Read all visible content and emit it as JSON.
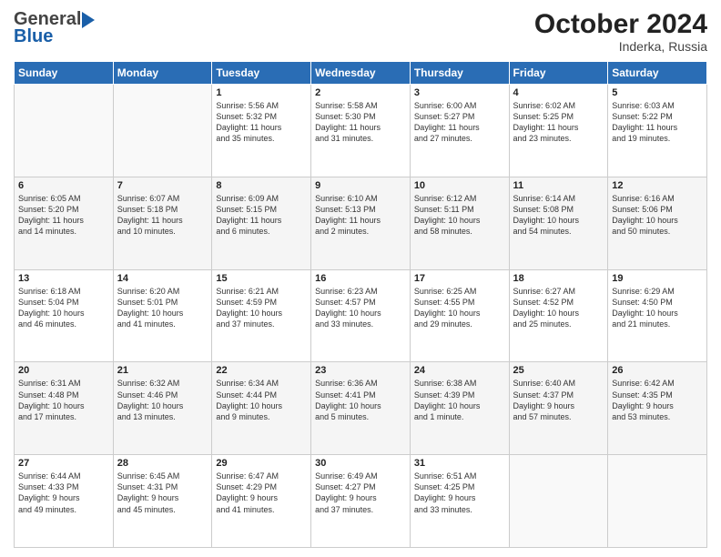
{
  "header": {
    "logo": {
      "line1": "General",
      "line2": "Blue"
    },
    "title": "October 2024",
    "location": "Inderka, Russia"
  },
  "weekdays": [
    "Sunday",
    "Monday",
    "Tuesday",
    "Wednesday",
    "Thursday",
    "Friday",
    "Saturday"
  ],
  "weeks": [
    [
      {
        "day": "",
        "info": ""
      },
      {
        "day": "",
        "info": ""
      },
      {
        "day": "1",
        "info": "Sunrise: 5:56 AM\nSunset: 5:32 PM\nDaylight: 11 hours\nand 35 minutes."
      },
      {
        "day": "2",
        "info": "Sunrise: 5:58 AM\nSunset: 5:30 PM\nDaylight: 11 hours\nand 31 minutes."
      },
      {
        "day": "3",
        "info": "Sunrise: 6:00 AM\nSunset: 5:27 PM\nDaylight: 11 hours\nand 27 minutes."
      },
      {
        "day": "4",
        "info": "Sunrise: 6:02 AM\nSunset: 5:25 PM\nDaylight: 11 hours\nand 23 minutes."
      },
      {
        "day": "5",
        "info": "Sunrise: 6:03 AM\nSunset: 5:22 PM\nDaylight: 11 hours\nand 19 minutes."
      }
    ],
    [
      {
        "day": "6",
        "info": "Sunrise: 6:05 AM\nSunset: 5:20 PM\nDaylight: 11 hours\nand 14 minutes."
      },
      {
        "day": "7",
        "info": "Sunrise: 6:07 AM\nSunset: 5:18 PM\nDaylight: 11 hours\nand 10 minutes."
      },
      {
        "day": "8",
        "info": "Sunrise: 6:09 AM\nSunset: 5:15 PM\nDaylight: 11 hours\nand 6 minutes."
      },
      {
        "day": "9",
        "info": "Sunrise: 6:10 AM\nSunset: 5:13 PM\nDaylight: 11 hours\nand 2 minutes."
      },
      {
        "day": "10",
        "info": "Sunrise: 6:12 AM\nSunset: 5:11 PM\nDaylight: 10 hours\nand 58 minutes."
      },
      {
        "day": "11",
        "info": "Sunrise: 6:14 AM\nSunset: 5:08 PM\nDaylight: 10 hours\nand 54 minutes."
      },
      {
        "day": "12",
        "info": "Sunrise: 6:16 AM\nSunset: 5:06 PM\nDaylight: 10 hours\nand 50 minutes."
      }
    ],
    [
      {
        "day": "13",
        "info": "Sunrise: 6:18 AM\nSunset: 5:04 PM\nDaylight: 10 hours\nand 46 minutes."
      },
      {
        "day": "14",
        "info": "Sunrise: 6:20 AM\nSunset: 5:01 PM\nDaylight: 10 hours\nand 41 minutes."
      },
      {
        "day": "15",
        "info": "Sunrise: 6:21 AM\nSunset: 4:59 PM\nDaylight: 10 hours\nand 37 minutes."
      },
      {
        "day": "16",
        "info": "Sunrise: 6:23 AM\nSunset: 4:57 PM\nDaylight: 10 hours\nand 33 minutes."
      },
      {
        "day": "17",
        "info": "Sunrise: 6:25 AM\nSunset: 4:55 PM\nDaylight: 10 hours\nand 29 minutes."
      },
      {
        "day": "18",
        "info": "Sunrise: 6:27 AM\nSunset: 4:52 PM\nDaylight: 10 hours\nand 25 minutes."
      },
      {
        "day": "19",
        "info": "Sunrise: 6:29 AM\nSunset: 4:50 PM\nDaylight: 10 hours\nand 21 minutes."
      }
    ],
    [
      {
        "day": "20",
        "info": "Sunrise: 6:31 AM\nSunset: 4:48 PM\nDaylight: 10 hours\nand 17 minutes."
      },
      {
        "day": "21",
        "info": "Sunrise: 6:32 AM\nSunset: 4:46 PM\nDaylight: 10 hours\nand 13 minutes."
      },
      {
        "day": "22",
        "info": "Sunrise: 6:34 AM\nSunset: 4:44 PM\nDaylight: 10 hours\nand 9 minutes."
      },
      {
        "day": "23",
        "info": "Sunrise: 6:36 AM\nSunset: 4:41 PM\nDaylight: 10 hours\nand 5 minutes."
      },
      {
        "day": "24",
        "info": "Sunrise: 6:38 AM\nSunset: 4:39 PM\nDaylight: 10 hours\nand 1 minute."
      },
      {
        "day": "25",
        "info": "Sunrise: 6:40 AM\nSunset: 4:37 PM\nDaylight: 9 hours\nand 57 minutes."
      },
      {
        "day": "26",
        "info": "Sunrise: 6:42 AM\nSunset: 4:35 PM\nDaylight: 9 hours\nand 53 minutes."
      }
    ],
    [
      {
        "day": "27",
        "info": "Sunrise: 6:44 AM\nSunset: 4:33 PM\nDaylight: 9 hours\nand 49 minutes."
      },
      {
        "day": "28",
        "info": "Sunrise: 6:45 AM\nSunset: 4:31 PM\nDaylight: 9 hours\nand 45 minutes."
      },
      {
        "day": "29",
        "info": "Sunrise: 6:47 AM\nSunset: 4:29 PM\nDaylight: 9 hours\nand 41 minutes."
      },
      {
        "day": "30",
        "info": "Sunrise: 6:49 AM\nSunset: 4:27 PM\nDaylight: 9 hours\nand 37 minutes."
      },
      {
        "day": "31",
        "info": "Sunrise: 6:51 AM\nSunset: 4:25 PM\nDaylight: 9 hours\nand 33 minutes."
      },
      {
        "day": "",
        "info": ""
      },
      {
        "day": "",
        "info": ""
      }
    ]
  ]
}
